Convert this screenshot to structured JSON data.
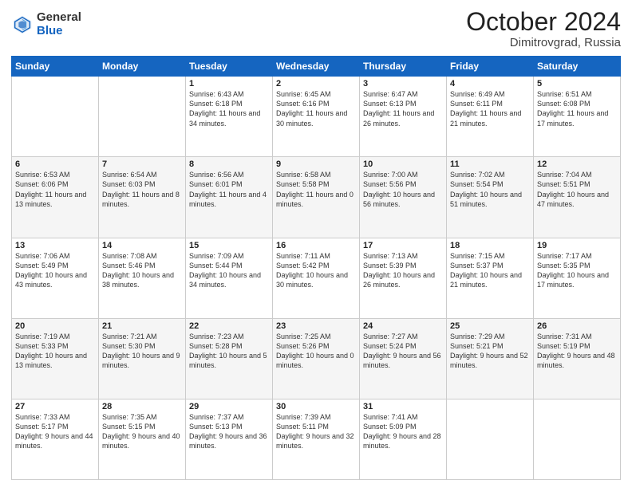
{
  "header": {
    "logo_general": "General",
    "logo_blue": "Blue",
    "month_title": "October 2024",
    "subtitle": "Dimitrovgrad, Russia"
  },
  "columns": [
    "Sunday",
    "Monday",
    "Tuesday",
    "Wednesday",
    "Thursday",
    "Friday",
    "Saturday"
  ],
  "weeks": [
    [
      {
        "day": "",
        "sunrise": "",
        "sunset": "",
        "daylight": ""
      },
      {
        "day": "",
        "sunrise": "",
        "sunset": "",
        "daylight": ""
      },
      {
        "day": "1",
        "sunrise": "Sunrise: 6:43 AM",
        "sunset": "Sunset: 6:18 PM",
        "daylight": "Daylight: 11 hours and 34 minutes."
      },
      {
        "day": "2",
        "sunrise": "Sunrise: 6:45 AM",
        "sunset": "Sunset: 6:16 PM",
        "daylight": "Daylight: 11 hours and 30 minutes."
      },
      {
        "day": "3",
        "sunrise": "Sunrise: 6:47 AM",
        "sunset": "Sunset: 6:13 PM",
        "daylight": "Daylight: 11 hours and 26 minutes."
      },
      {
        "day": "4",
        "sunrise": "Sunrise: 6:49 AM",
        "sunset": "Sunset: 6:11 PM",
        "daylight": "Daylight: 11 hours and 21 minutes."
      },
      {
        "day": "5",
        "sunrise": "Sunrise: 6:51 AM",
        "sunset": "Sunset: 6:08 PM",
        "daylight": "Daylight: 11 hours and 17 minutes."
      }
    ],
    [
      {
        "day": "6",
        "sunrise": "Sunrise: 6:53 AM",
        "sunset": "Sunset: 6:06 PM",
        "daylight": "Daylight: 11 hours and 13 minutes."
      },
      {
        "day": "7",
        "sunrise": "Sunrise: 6:54 AM",
        "sunset": "Sunset: 6:03 PM",
        "daylight": "Daylight: 11 hours and 8 minutes."
      },
      {
        "day": "8",
        "sunrise": "Sunrise: 6:56 AM",
        "sunset": "Sunset: 6:01 PM",
        "daylight": "Daylight: 11 hours and 4 minutes."
      },
      {
        "day": "9",
        "sunrise": "Sunrise: 6:58 AM",
        "sunset": "Sunset: 5:58 PM",
        "daylight": "Daylight: 11 hours and 0 minutes."
      },
      {
        "day": "10",
        "sunrise": "Sunrise: 7:00 AM",
        "sunset": "Sunset: 5:56 PM",
        "daylight": "Daylight: 10 hours and 56 minutes."
      },
      {
        "day": "11",
        "sunrise": "Sunrise: 7:02 AM",
        "sunset": "Sunset: 5:54 PM",
        "daylight": "Daylight: 10 hours and 51 minutes."
      },
      {
        "day": "12",
        "sunrise": "Sunrise: 7:04 AM",
        "sunset": "Sunset: 5:51 PM",
        "daylight": "Daylight: 10 hours and 47 minutes."
      }
    ],
    [
      {
        "day": "13",
        "sunrise": "Sunrise: 7:06 AM",
        "sunset": "Sunset: 5:49 PM",
        "daylight": "Daylight: 10 hours and 43 minutes."
      },
      {
        "day": "14",
        "sunrise": "Sunrise: 7:08 AM",
        "sunset": "Sunset: 5:46 PM",
        "daylight": "Daylight: 10 hours and 38 minutes."
      },
      {
        "day": "15",
        "sunrise": "Sunrise: 7:09 AM",
        "sunset": "Sunset: 5:44 PM",
        "daylight": "Daylight: 10 hours and 34 minutes."
      },
      {
        "day": "16",
        "sunrise": "Sunrise: 7:11 AM",
        "sunset": "Sunset: 5:42 PM",
        "daylight": "Daylight: 10 hours and 30 minutes."
      },
      {
        "day": "17",
        "sunrise": "Sunrise: 7:13 AM",
        "sunset": "Sunset: 5:39 PM",
        "daylight": "Daylight: 10 hours and 26 minutes."
      },
      {
        "day": "18",
        "sunrise": "Sunrise: 7:15 AM",
        "sunset": "Sunset: 5:37 PM",
        "daylight": "Daylight: 10 hours and 21 minutes."
      },
      {
        "day": "19",
        "sunrise": "Sunrise: 7:17 AM",
        "sunset": "Sunset: 5:35 PM",
        "daylight": "Daylight: 10 hours and 17 minutes."
      }
    ],
    [
      {
        "day": "20",
        "sunrise": "Sunrise: 7:19 AM",
        "sunset": "Sunset: 5:33 PM",
        "daylight": "Daylight: 10 hours and 13 minutes."
      },
      {
        "day": "21",
        "sunrise": "Sunrise: 7:21 AM",
        "sunset": "Sunset: 5:30 PM",
        "daylight": "Daylight: 10 hours and 9 minutes."
      },
      {
        "day": "22",
        "sunrise": "Sunrise: 7:23 AM",
        "sunset": "Sunset: 5:28 PM",
        "daylight": "Daylight: 10 hours and 5 minutes."
      },
      {
        "day": "23",
        "sunrise": "Sunrise: 7:25 AM",
        "sunset": "Sunset: 5:26 PM",
        "daylight": "Daylight: 10 hours and 0 minutes."
      },
      {
        "day": "24",
        "sunrise": "Sunrise: 7:27 AM",
        "sunset": "Sunset: 5:24 PM",
        "daylight": "Daylight: 9 hours and 56 minutes."
      },
      {
        "day": "25",
        "sunrise": "Sunrise: 7:29 AM",
        "sunset": "Sunset: 5:21 PM",
        "daylight": "Daylight: 9 hours and 52 minutes."
      },
      {
        "day": "26",
        "sunrise": "Sunrise: 7:31 AM",
        "sunset": "Sunset: 5:19 PM",
        "daylight": "Daylight: 9 hours and 48 minutes."
      }
    ],
    [
      {
        "day": "27",
        "sunrise": "Sunrise: 7:33 AM",
        "sunset": "Sunset: 5:17 PM",
        "daylight": "Daylight: 9 hours and 44 minutes."
      },
      {
        "day": "28",
        "sunrise": "Sunrise: 7:35 AM",
        "sunset": "Sunset: 5:15 PM",
        "daylight": "Daylight: 9 hours and 40 minutes."
      },
      {
        "day": "29",
        "sunrise": "Sunrise: 7:37 AM",
        "sunset": "Sunset: 5:13 PM",
        "daylight": "Daylight: 9 hours and 36 minutes."
      },
      {
        "day": "30",
        "sunrise": "Sunrise: 7:39 AM",
        "sunset": "Sunset: 5:11 PM",
        "daylight": "Daylight: 9 hours and 32 minutes."
      },
      {
        "day": "31",
        "sunrise": "Sunrise: 7:41 AM",
        "sunset": "Sunset: 5:09 PM",
        "daylight": "Daylight: 9 hours and 28 minutes."
      },
      {
        "day": "",
        "sunrise": "",
        "sunset": "",
        "daylight": ""
      },
      {
        "day": "",
        "sunrise": "",
        "sunset": "",
        "daylight": ""
      }
    ]
  ]
}
